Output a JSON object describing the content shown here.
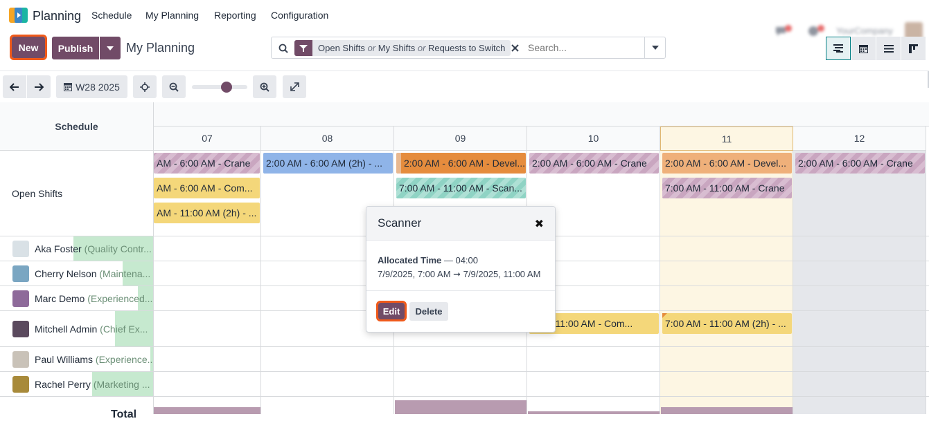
{
  "topnav": {
    "app_name": "Planning",
    "menu": [
      "Schedule",
      "My Planning",
      "Reporting",
      "Configuration"
    ],
    "company": "YourCompany"
  },
  "control_panel": {
    "new_label": "New",
    "publish_label": "Publish",
    "breadcrumb": "My Planning",
    "search": {
      "facet_parts": [
        "Open Shifts",
        "or",
        "My Shifts",
        "or",
        "Requests to Switch"
      ],
      "placeholder": "Search..."
    },
    "views": [
      "gantt-view-icon",
      "calendar-view-icon",
      "list-view-icon",
      "kanban-view-icon"
    ]
  },
  "toolbar": {
    "week_label": "W28 2025"
  },
  "gantt": {
    "header_label": "Schedule",
    "days": [
      "07",
      "08",
      "09",
      "10",
      "11",
      "12"
    ],
    "today": "11",
    "rows": [
      {
        "name": "Open Shifts",
        "job": ""
      },
      {
        "name": "Aka Foster",
        "job": "(Quality Contr..."
      },
      {
        "name": "Cherry Nelson",
        "job": "(Maintena..."
      },
      {
        "name": "Marc Demo",
        "job": "(Experienced..."
      },
      {
        "name": "Mitchell Admin",
        "job": "(Chief Ex..."
      },
      {
        "name": "Paul Williams",
        "job": "(Experience..."
      },
      {
        "name": "Rachel Perry",
        "job": "(Marketing ..."
      }
    ],
    "row_progress": [
      0,
      0.52,
      0.2,
      0.1,
      0.25,
      0.02,
      0.4
    ],
    "total_label": "Total",
    "pills": [
      "AM - 6:00 AM - Crane",
      "AM - 6:00 AM - Com...",
      "AM - 11:00 AM (2h) - ...",
      "2:00 AM - 6:00 AM (2h) - ...",
      "2:00 AM - 6:00 AM - Devel...",
      "7:00 AM - 11:00 AM - Scan...",
      "2:00 AM - 6:00 AM - Crane",
      "2:00 AM - 6:00 AM - Devel...",
      "7:00 AM - 11:00 AM - Crane",
      "2:00 AM - 6:00 AM - Crane",
      "AM - 11:00 AM - Com...",
      "7:00 AM - 11:00 AM (2h) - ..."
    ]
  },
  "popover": {
    "title": "Scanner",
    "close": "✖",
    "allocated_label": "Allocated Time",
    "allocated_value": "— 04:00",
    "range": "7/9/2025, 7:00 AM ➞ 7/9/2025, 11:00 AM",
    "edit_label": "Edit",
    "delete_label": "Delete"
  },
  "colors": {
    "brand": "#714b67",
    "highlight": "#f05a1a",
    "today_bg": "#fdf6e3"
  }
}
